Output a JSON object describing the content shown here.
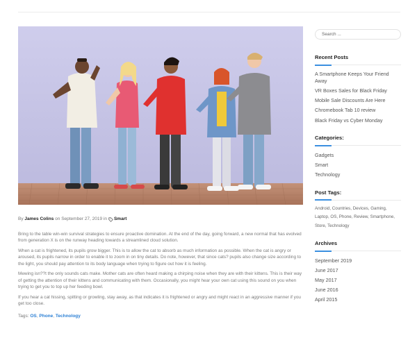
{
  "post": {
    "meta": {
      "by": "By",
      "author": "James Colins",
      "on": "on",
      "date": "September 27, 2019",
      "in": "in",
      "category": "Smart"
    },
    "paragraphs": [
      "Bring to the table win-win survival strategies to ensure proactive domination. At the end of the day, going forward, a new normal that has evolved from generation X is on the runway heading towards a streamlined cloud solution.",
      "When a cat is frightened, its pupils grow bigger. This is to allow the cat to absorb as much information as possible. When the cat is angry or aroused, its pupils narrow in order to enable it to zoom in on tiny details. Do note, however, that since cats? pupils also change size according to the light, you should pay attention to its body language when trying to figure out how it is feeling.",
      "Mewing isn??t the only sounds cats make. Mother cats are often heard making a chirping noise when they are with their kittens. This is their way of getting the attention of their kittens and communicating with them. Occasionally, you might hear your own cat using this sound on you when trying to get you to top up her feeding bowl."
    ],
    "p4_before": "If you hear a cat hissing, spitting or growling, stay away, as that indicates it is frightened or angry and might react in an ",
    "p4_em": "aggressive",
    "p4_after": " manner if you get too close.",
    "tags_label": "Tags:",
    "tags": [
      "OS",
      "Phone",
      "Technology"
    ]
  },
  "sidebar": {
    "search_placeholder": "Search ...",
    "recent_posts": {
      "title": "Recent Posts",
      "items": [
        "A Smartphone Keeps Your Friend Away",
        "VR Boxes Sales for Black Friday",
        "Mobile Sale Discounts Are Here",
        "Chromebook Tab 10 review",
        "Black Friday vs Cyber Monday"
      ]
    },
    "categories": {
      "title": "Categories:",
      "items": [
        "Gadgets",
        "Smart",
        "Technology"
      ]
    },
    "post_tags": {
      "title": "Post Tags:",
      "items": [
        "Android",
        "Countries",
        "Devices",
        "Gaming",
        "Laptop",
        "OS",
        "Phone",
        "Review",
        "Smartphone",
        "Store",
        "Technology"
      ]
    },
    "archives": {
      "title": "Archives",
      "items": [
        "September 2019",
        "June 2017",
        "May 2017",
        "June 2016",
        "April 2015"
      ]
    }
  },
  "colors": {
    "accent": "#3a8fe0",
    "link": "#2b7fd4",
    "wall": "#c8c6e6",
    "pavement": "#b88466"
  },
  "icons": {
    "category": "tag-icon"
  }
}
